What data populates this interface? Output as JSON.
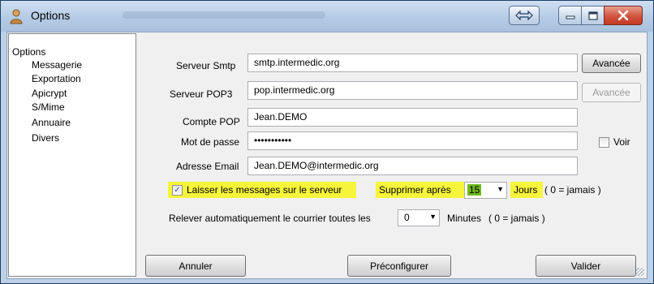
{
  "window": {
    "title": "Options"
  },
  "colors": {
    "highlight": "#f6f53b",
    "title_bar": "#b5cbe5",
    "close_button": "#d0533d"
  },
  "tree": {
    "root": "Options",
    "items": [
      "Messagerie",
      "Exportation",
      "Apicrypt",
      "S/Mime",
      "Annuaire",
      "Divers"
    ]
  },
  "form": {
    "smtp": {
      "label": "Serveur Smtp",
      "value": "smtp.intermedic.org",
      "button": "Avancée"
    },
    "pop3": {
      "label": "Serveur POP3",
      "value": "pop.intermedic.org",
      "button": "Avancée"
    },
    "account": {
      "label": "Compte POP",
      "value": "Jean.DEMO"
    },
    "password": {
      "label": "Mot de passe",
      "value": "•••••••••••",
      "show_label": "Voir"
    },
    "email": {
      "label": "Adresse Email",
      "value": "Jean.DEMO@intermedic.org"
    },
    "leave_on_server": {
      "label": "Laisser les messages sur le serveur",
      "checked": true,
      "mark": "✓"
    },
    "delete_after": {
      "label": "Supprimer après",
      "value": "15",
      "unit": "Jours",
      "note": "( 0 = jamais )"
    },
    "auto_check": {
      "label": "Relever automatiquement le courrier toutes les",
      "value": "0",
      "unit": "Minutes",
      "note": "( 0 = jamais )"
    }
  },
  "buttons": {
    "cancel": "Annuler",
    "preconfigure": "Préconfigurer",
    "validate": "Valider"
  }
}
